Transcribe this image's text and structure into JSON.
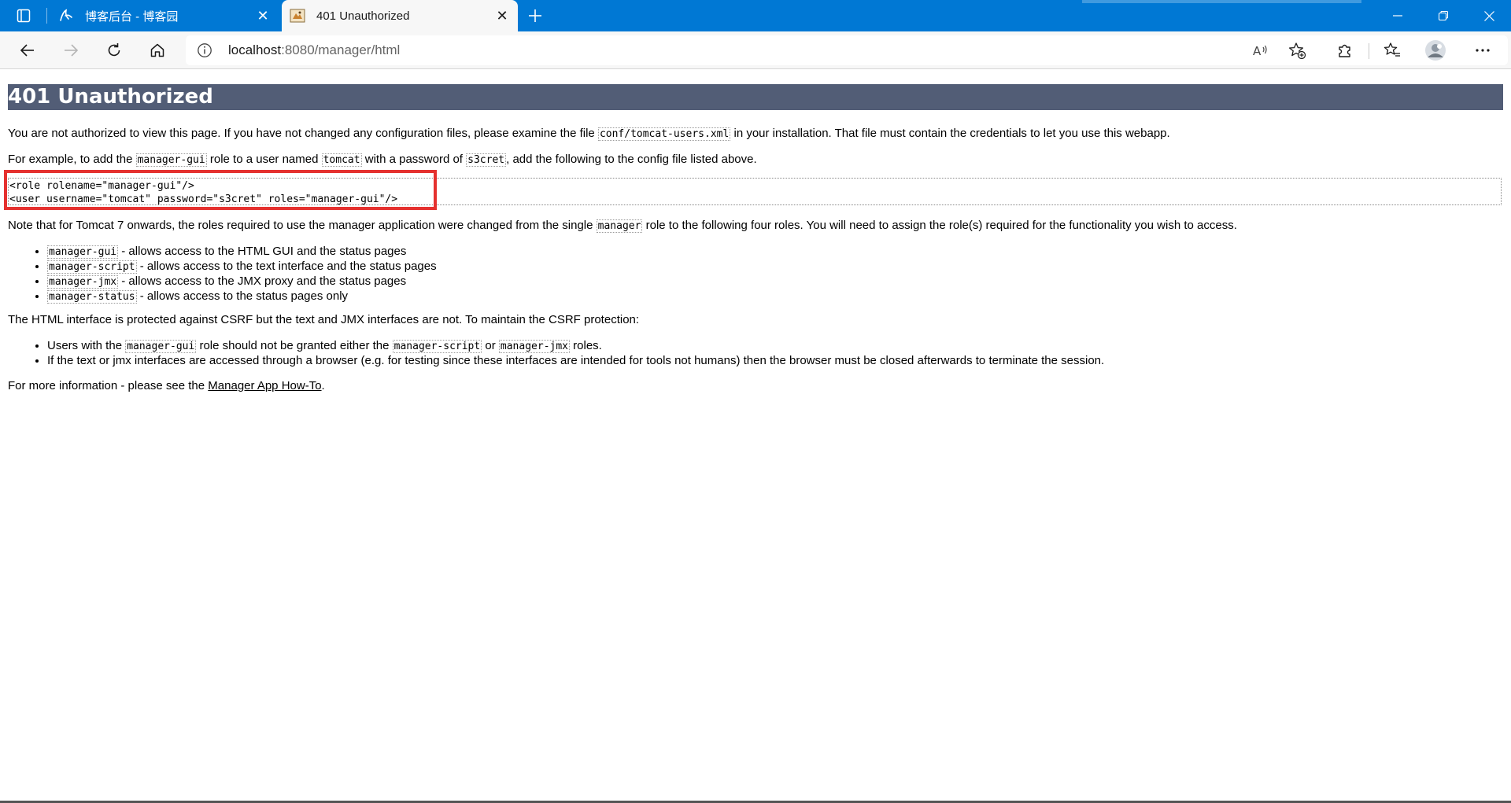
{
  "browser": {
    "tabs": [
      {
        "label": "博客后台 - 博客园",
        "favicon": "cnblogs-favicon",
        "active": false
      },
      {
        "label": "401 Unauthorized",
        "favicon": "tomcat-favicon",
        "active": true
      }
    ],
    "address": {
      "host": "localhost",
      "path": ":8080/manager/html"
    }
  },
  "page": {
    "heading": "401 Unauthorized",
    "p1": {
      "before": "You are not authorized to view this page. If you have not changed any configuration files, please examine the file ",
      "code": "conf/tomcat-users.xml",
      "after": " in your installation. That file must contain the credentials to let you use this webapp."
    },
    "p2": {
      "t1": "For example, to add the ",
      "c1": "manager-gui",
      "t2": " role to a user named ",
      "c2": "tomcat",
      "t3": " with a password of ",
      "c3": "s3cret",
      "t4": ", add the following to the config file listed above."
    },
    "pre": {
      "line1": "<role rolename=\"manager-gui\"/>",
      "line2": "<user username=\"tomcat\" password=\"s3cret\" roles=\"manager-gui\"/>"
    },
    "p3": {
      "before": "Note that for Tomcat 7 onwards, the roles required to use the manager application were changed from the single ",
      "code": "manager",
      "after": " role to the following four roles. You will need to assign the role(s) required for the functionality you wish to access."
    },
    "roles": [
      {
        "code": "manager-gui",
        "text": " - allows access to the HTML GUI and the status pages"
      },
      {
        "code": "manager-script",
        "text": " - allows access to the text interface and the status pages"
      },
      {
        "code": "manager-jmx",
        "text": " - allows access to the JMX proxy and the status pages"
      },
      {
        "code": "manager-status",
        "text": " - allows access to the status pages only"
      }
    ],
    "p4": "The HTML interface is protected against CSRF but the text and JMX interfaces are not. To maintain the CSRF protection:",
    "csrf1": {
      "t1": "Users with the ",
      "c1": "manager-gui",
      "t2": " role should not be granted either the ",
      "c2": "manager-script",
      "t3": " or ",
      "c3": "manager-jmx",
      "t4": " roles."
    },
    "csrf2": "If the text or jmx interfaces are accessed through a browser (e.g. for testing since these interfaces are intended for tools not humans) then the browser must be closed afterwards to terminate the session.",
    "p5": {
      "before": "For more information - please see the ",
      "link": "Manager App How-To",
      "after": "."
    }
  },
  "colors": {
    "tabstrip": "#0078d4",
    "heading_bg": "#525d76",
    "highlight": "#e5312f"
  }
}
